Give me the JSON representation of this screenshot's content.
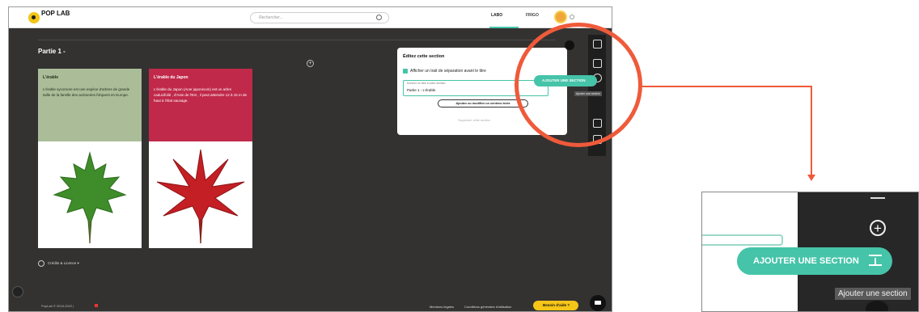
{
  "app": {
    "logo_text": "POP LAB",
    "search_placeholder": "Rechercher...",
    "nav": {
      "labo": "LABO",
      "frigo": "FRIGO"
    }
  },
  "section": {
    "title": "Partie 1 -"
  },
  "cards": [
    {
      "title": "L'érable",
      "text": "L'érable sycomore est une espèce d'arbres de grande taille de la famille des acéracées fréquent en Europe.",
      "color": "#aabd98"
    },
    {
      "title": "L'érable du Japon",
      "text": "L'érable du Japon (Acer japonicum) est un arbre caducifolié , d'Asie de l'Est , il peut atteindre 12 à 15 m de haut à l'état sauvage.",
      "color": "#c0294a"
    }
  ],
  "edit_panel": {
    "title": "Éditez cette section",
    "checkbox_label": "Afficher un trait de séparation avant le titre",
    "field_placeholder": "Donnez un titre à votre section",
    "field_value": "Partie 1 - L'érable",
    "add_content_label": "Ajoutez ou modifiez un contenu texte",
    "delete_label": "Supprimer cette section"
  },
  "add_section_label": "AJOUTER UNE SECTION",
  "tooltip_small": "Ajouter une section",
  "footer": {
    "credits": "Crédits & Licence",
    "copyright": "PopLab © 2018-2022 |",
    "legal": "Mentions légales",
    "cgu": "Conditions générales d'utilisation",
    "help": "Besoin d'aide ?"
  },
  "zoom": {
    "add_section_label": "AJOUTER UNE SECTION",
    "tooltip": "Ajouter une section"
  },
  "colors": {
    "accent": "#45c4a9",
    "highlight": "#ef5a3a",
    "help": "#f5c518"
  }
}
